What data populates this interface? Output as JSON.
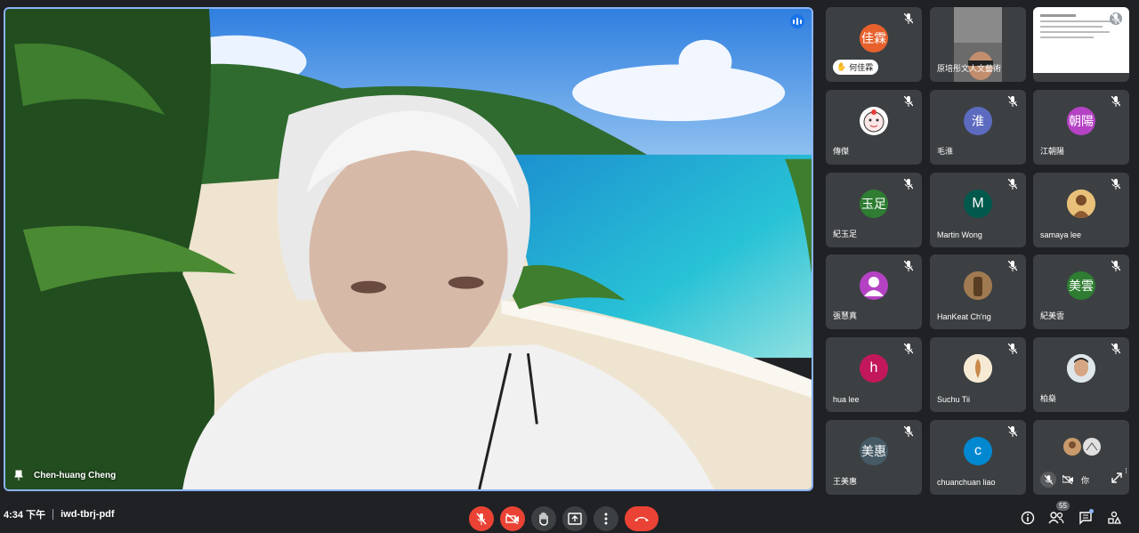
{
  "main_speaker": {
    "name": "Chen-huang Cheng"
  },
  "participants": [
    {
      "name": "何佳霖",
      "initials": "佳霖",
      "avatar_color": "#e8612c",
      "hand_raised": true
    },
    {
      "name": "原培彤文人文藝術",
      "initials": "",
      "avatar_type": "video"
    },
    {
      "name": "",
      "initials": "",
      "avatar_type": "screen"
    },
    {
      "name": "傳傑",
      "initials": "",
      "avatar_type": "cartoon"
    },
    {
      "name": "毛淮",
      "initials": "淮",
      "avatar_color": "#5c6bc0"
    },
    {
      "name": "江朝陽",
      "initials": "朝陽",
      "avatar_color": "#b542c4"
    },
    {
      "name": "紀玉足",
      "initials": "玉足",
      "avatar_color": "#2e7d32"
    },
    {
      "name": "Martin Wong",
      "initials": "M",
      "avatar_color": "#00594c"
    },
    {
      "name": "samaya lee",
      "initials": "",
      "avatar_type": "photo"
    },
    {
      "name": "張慧真",
      "initials": "",
      "avatar_color": "#b542c4",
      "avatar_type": "person"
    },
    {
      "name": "HanKeat Ch'ng",
      "initials": "",
      "avatar_type": "photo"
    },
    {
      "name": "紀美雲",
      "initials": "美雲",
      "avatar_color": "#2e7d32"
    },
    {
      "name": "hua lee",
      "initials": "h",
      "avatar_color": "#c2185b"
    },
    {
      "name": "Suchu Tii",
      "initials": "",
      "avatar_type": "photo"
    },
    {
      "name": "柏燊",
      "initials": "",
      "avatar_type": "photo"
    },
    {
      "name": "王美惠",
      "initials": "美惠",
      "avatar_color": "#455a64"
    },
    {
      "name": "chuanchuan liao",
      "initials": "c",
      "avatar_color": "#0288d1"
    },
    {
      "name": "你",
      "initials": "",
      "avatar_type": "self"
    }
  ],
  "bottom_bar": {
    "time": "4:34 下午",
    "meeting_code": "iwd-tbrj-pdf",
    "participant_count": "55"
  },
  "icons": {
    "mic": "mic-off-icon",
    "camera": "camera-off-icon",
    "hand": "raise-hand-icon",
    "present": "present-screen-icon",
    "more": "more-options-icon",
    "leave": "leave-call-icon",
    "info": "meeting-info-icon",
    "people": "people-icon",
    "chat": "chat-icon",
    "activities": "activities-icon"
  },
  "colors": {
    "accent": "#8ab4f8",
    "danger": "#ea4335",
    "tile_bg": "#3c4043",
    "page_bg": "#202124"
  }
}
